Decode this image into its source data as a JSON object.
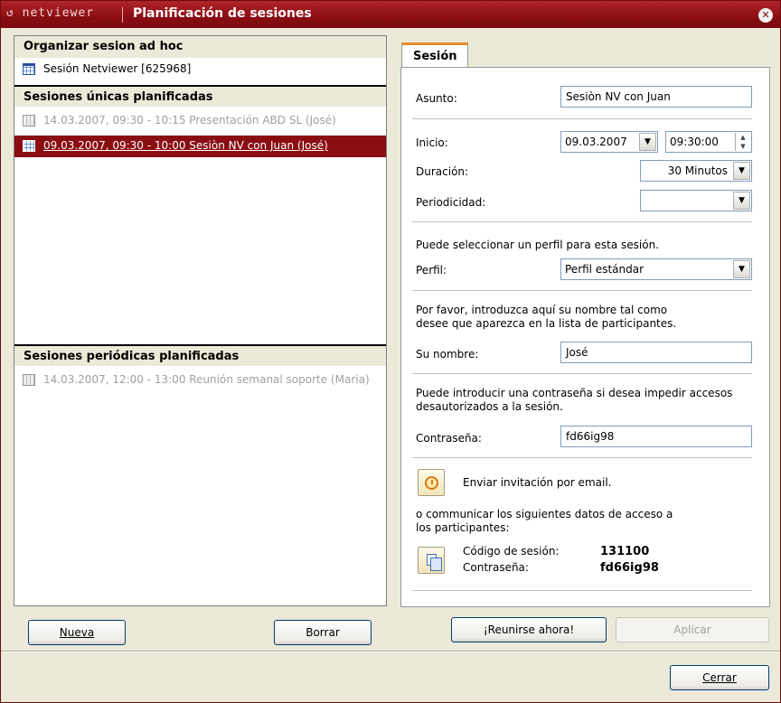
{
  "titlebar": {
    "logo": "netviewer",
    "title": "Planificación de sesiones"
  },
  "left": {
    "adhoc_header": "Organizar sesion ad hoc",
    "adhoc_item": "Sesión Netviewer [625968]",
    "unique_header": "Sesiones únicas planificadas",
    "unique_items": [
      "14.03.2007, 09:30 - 10:15 Presentación ABD SL (José)",
      "09.03.2007, 09:30 - 10:00 Sesiòn NV con Juan (José)"
    ],
    "periodic_header": "Sesiones periódicas planificadas",
    "periodic_items": [
      "14.03.2007, 12:00 - 13:00 Reunión semanal soporte (Maria)"
    ],
    "new_button": "Nueva",
    "delete_button": "Borrar"
  },
  "tab": {
    "label": "Sesión"
  },
  "form": {
    "subject_label": "Asunto:",
    "subject_value": "Sesiòn NV con Juan",
    "start_label": "Inicio:",
    "start_date": "09.03.2007",
    "start_time": "09:30:00",
    "duration_label": "Duración:",
    "duration_value": "30 Minutos",
    "periodicity_label": "Periodicidad:",
    "periodicity_value": "",
    "profile_hint": "Puede seleccionar un perfil para esta sesión.",
    "profile_label": "Perfil:",
    "profile_value": "Perfil estándar",
    "name_hint_1": "Por favor, introduzca aquí su nombre tal como",
    "name_hint_2": "desee que aparezca en la lista de participantes.",
    "name_label": "Su nombre:",
    "name_value": "José",
    "password_hint_1": "Puede introducir una contraseña si desea impedir accesos",
    "password_hint_2": "desautorizados a la sesión.",
    "password_label": "Contraseña:",
    "password_value": "fd66ig98",
    "invite_label": "Enviar invitación por email.",
    "communicate_1": "o communicar los siguientes datos de acceso a",
    "communicate_2": "los participantes:",
    "session_code_label": "Código de sesión:",
    "session_code_value": "131100",
    "access_password_label": "Contraseña:",
    "access_password_value": "fd66ig98"
  },
  "actions": {
    "meet_now": "¡Reunirse ahora!",
    "apply": "Aplicar",
    "close": "Cerrar"
  }
}
